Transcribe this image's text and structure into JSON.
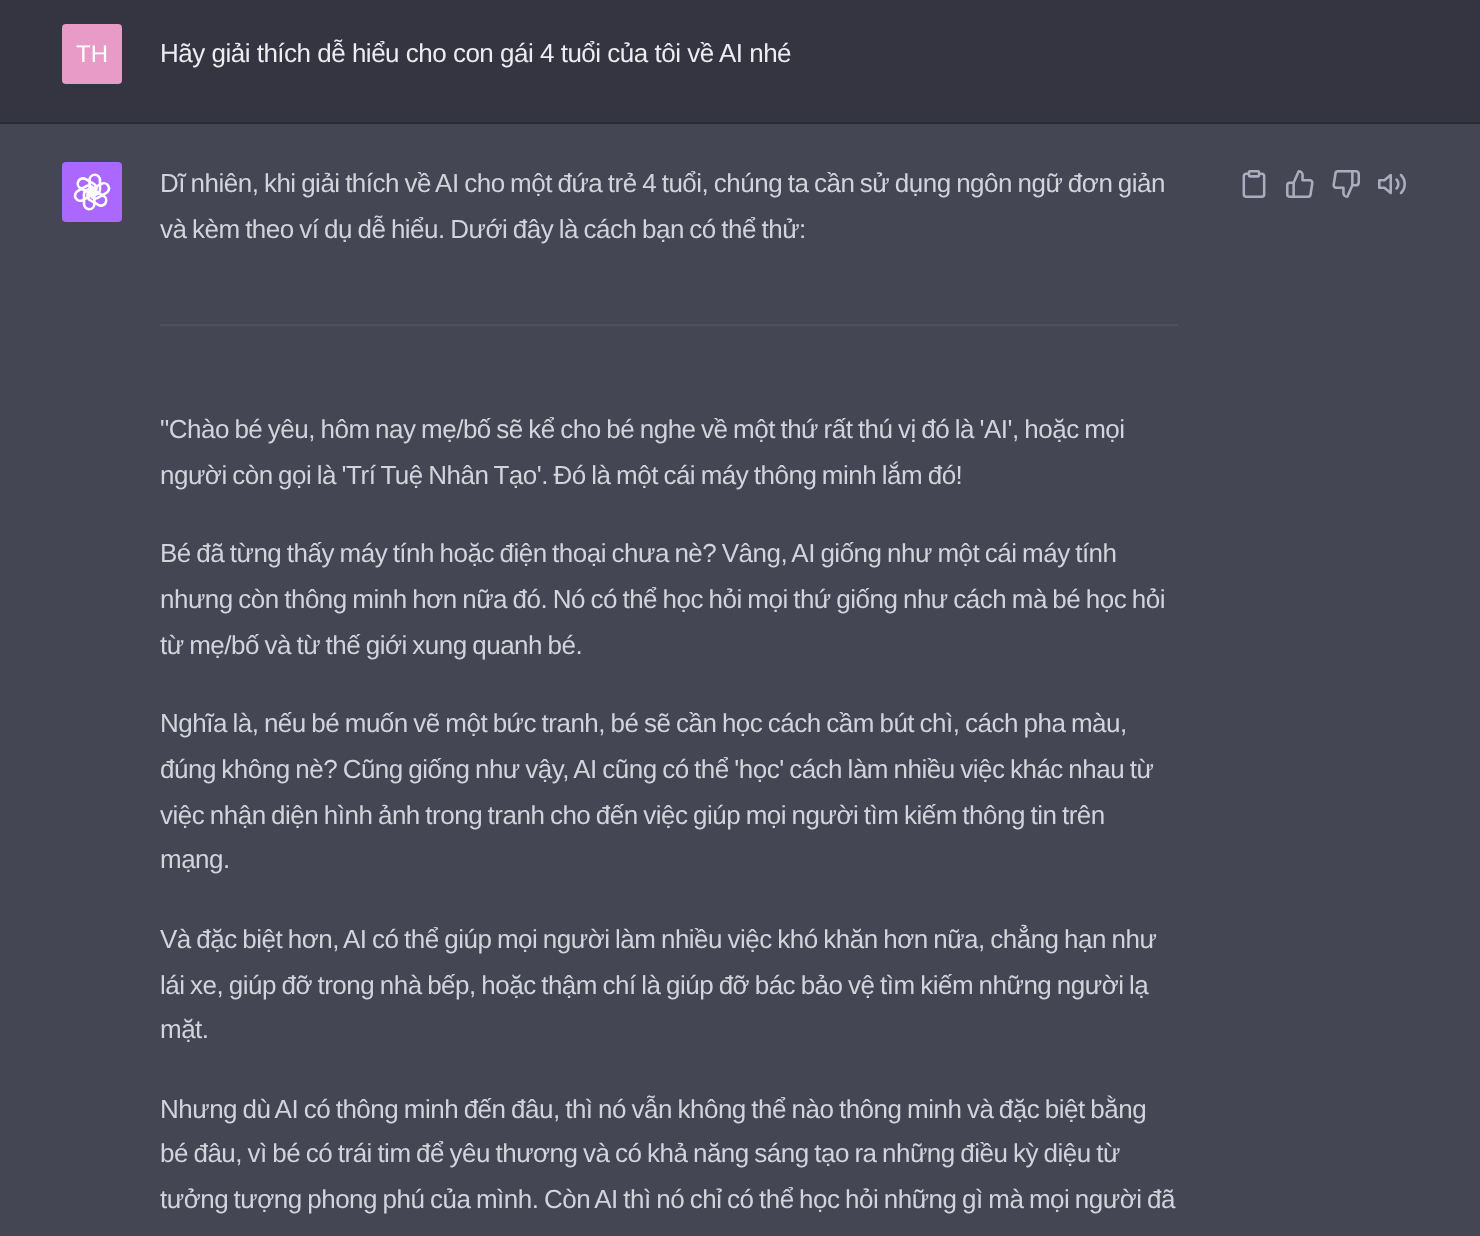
{
  "messages": [
    {
      "kind": "user",
      "avatar": "TH",
      "blocks": [
        {
          "kind": "paragraph",
          "text": "Hãy giải thích dễ hiểu cho con gái 4 tuổi của tôi về AI nhé"
        }
      ]
    },
    {
      "kind": "assistant",
      "blocks": [
        {
          "kind": "paragraph",
          "text": "Dĩ nhiên, khi giải thích về AI cho một đứa trẻ 4 tuổi, chúng ta cần sử dụng ngôn ngữ đơn giản và kèm theo ví dụ dễ hiểu. Dưới đây là cách bạn có thể thử:"
        },
        {
          "kind": "divider"
        },
        {
          "kind": "paragraph",
          "text": "\"Chào bé yêu, hôm nay mẹ/bố sẽ kể cho bé nghe về một thứ rất thú vị đó là 'AI', hoặc mọi người còn gọi là 'Trí Tuệ Nhân Tạo'. Đó là một cái máy thông minh lắm đó!"
        },
        {
          "kind": "paragraph",
          "text": "Bé đã từng thấy máy tính hoặc điện thoại chưa nè? Vâng, AI giống như một cái máy tính nhưng còn thông minh hơn nữa đó. Nó có thể học hỏi mọi thứ giống như cách mà bé học hỏi từ mẹ/bố và từ thế giới xung quanh bé."
        },
        {
          "kind": "paragraph",
          "text": "Nghĩa là, nếu bé muốn vẽ một bức tranh, bé sẽ cần học cách cầm bút chì, cách pha màu, đúng không nè? Cũng giống như vậy, AI cũng có thể 'học' cách làm nhiều việc khác nhau từ việc nhận diện hình ảnh trong tranh cho đến việc giúp mọi người tìm kiếm thông tin trên mạng."
        },
        {
          "kind": "paragraph",
          "text": "Và đặc biệt hơn, AI có thể giúp mọi người làm nhiều việc khó khăn hơn nữa, chẳng hạn như lái xe, giúp đỡ trong nhà bếp, hoặc thậm chí là giúp đỡ bác bảo vệ tìm kiếm những người lạ mặt."
        },
        {
          "kind": "paragraph",
          "text": "Nhưng dù AI có thông minh đến đâu, thì nó vẫn không thể nào thông minh và đặc biệt bằng bé đâu, vì bé có trái tim để yêu thương và có khả năng sáng tạo ra những điều kỳ diệu từ tưởng tượng phong phú của mình. Còn AI thì nó chỉ có thể học hỏi những gì mà mọi người đã"
        }
      ]
    }
  ]
}
